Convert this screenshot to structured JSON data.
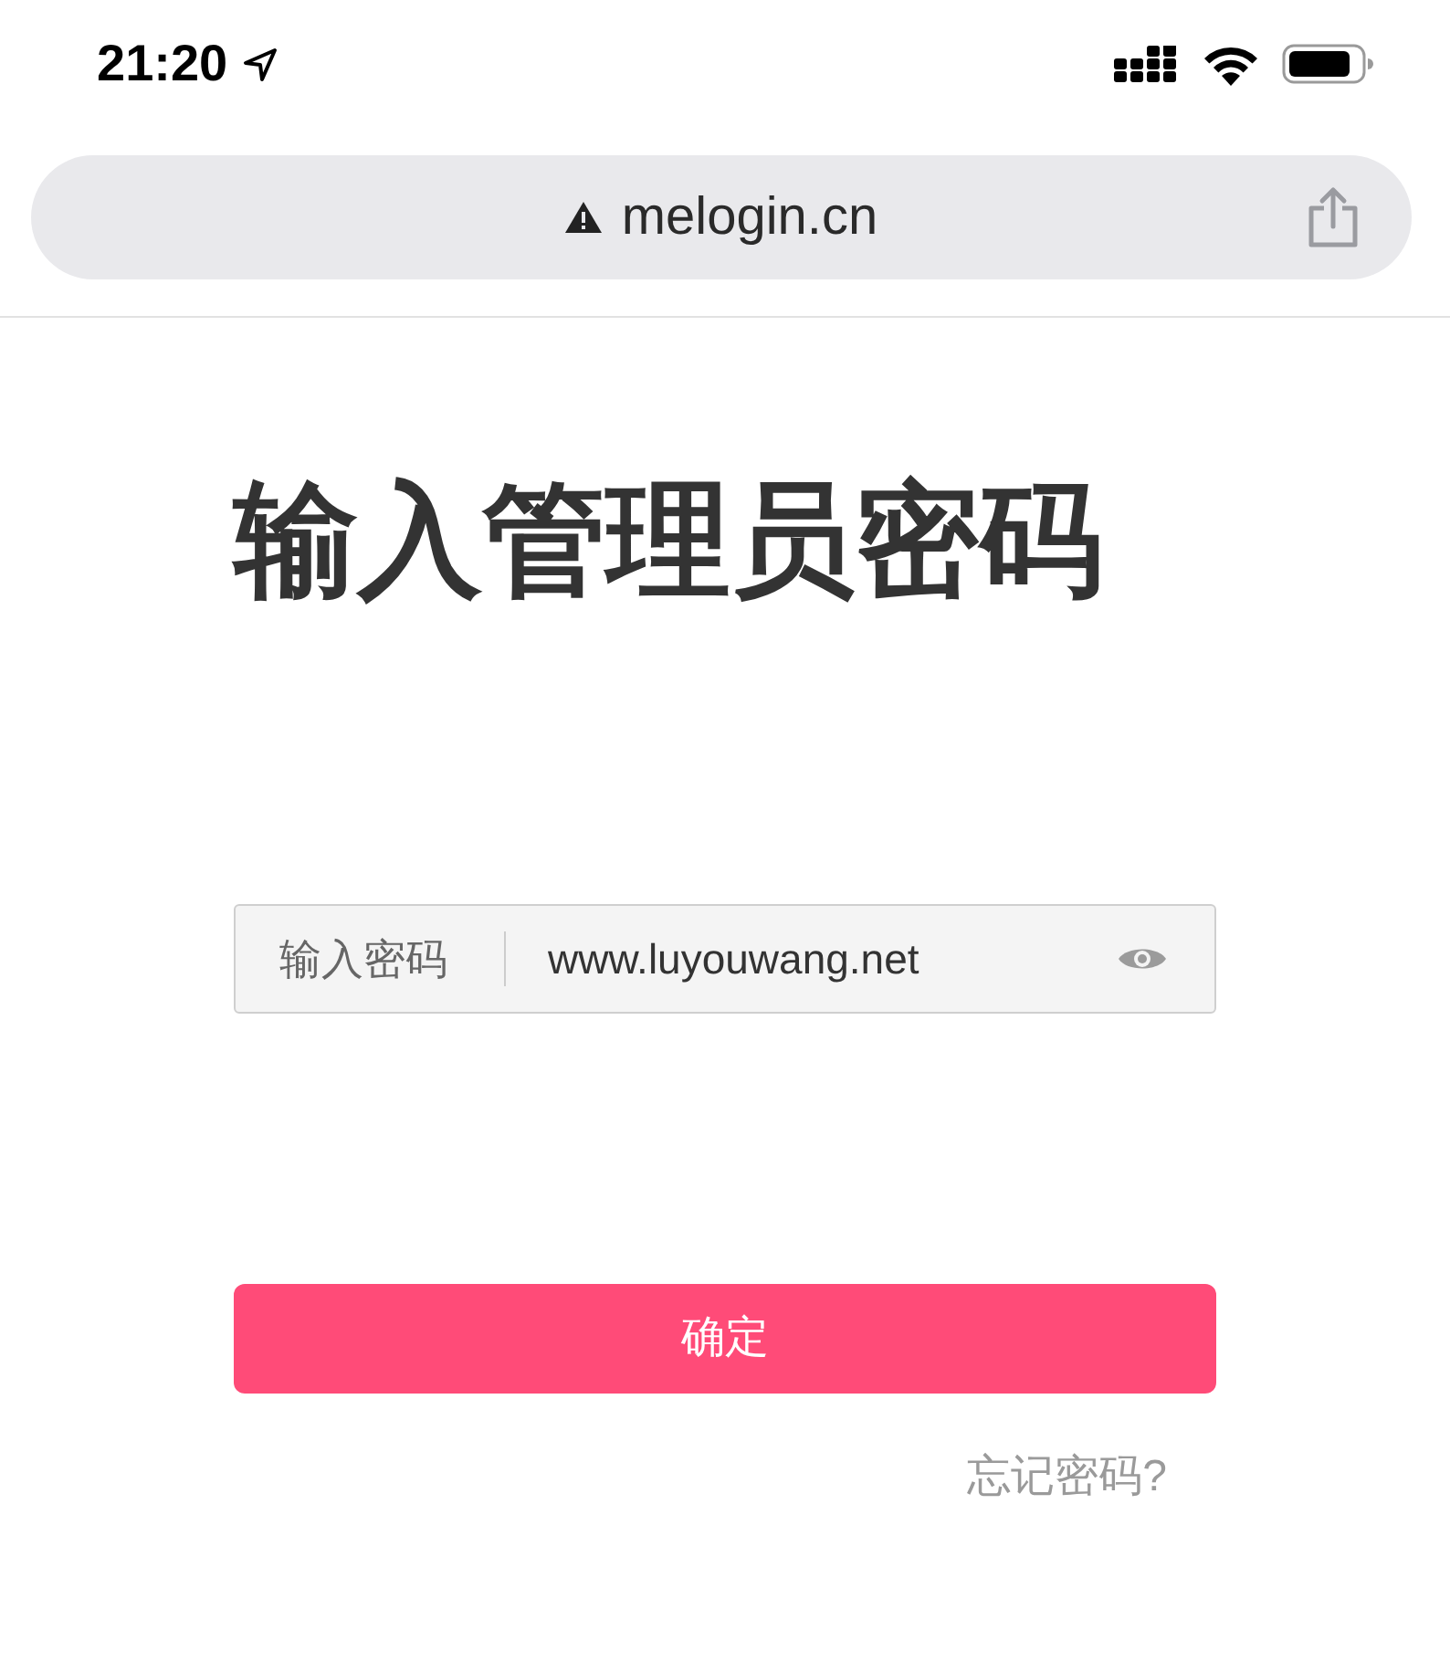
{
  "status_bar": {
    "time": "21:20"
  },
  "address_bar": {
    "url": "melogin.cn"
  },
  "title": "输入管理员密码",
  "password_field": {
    "label": "输入密码",
    "value": "www.luyouwang.net"
  },
  "confirm_button": {
    "label": "确定"
  },
  "forgot_link": {
    "label": "忘记密码?"
  }
}
